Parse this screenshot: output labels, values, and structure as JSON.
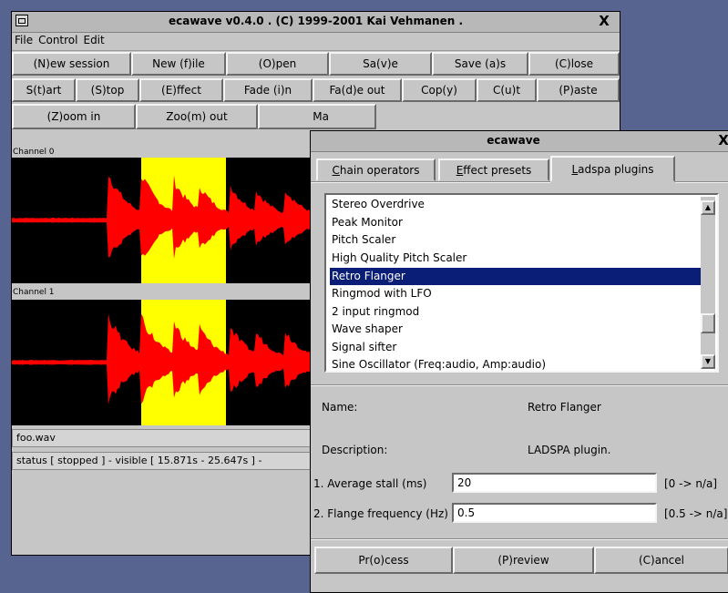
{
  "main_window": {
    "title": "ecawave v0.4.0 . (C) 1999-2001 Kai Vehmanen .",
    "close": "X",
    "menu": [
      "File",
      "Control",
      "Edit"
    ],
    "buttons_row1": [
      "(N)ew session",
      "New (f)ile",
      "(O)pen",
      "Sa(v)e",
      "Save (a)s",
      "(C)lose"
    ],
    "buttons_row2": [
      "S(t)art",
      "(S)top",
      "(E)ffect",
      "Fade (i)n",
      "Fa(d)e out",
      "Cop(y)",
      "C(u)t",
      "(P)aste"
    ],
    "buttons_row3": [
      "(Z)oom in",
      "Zoo(m) out",
      "Ma"
    ],
    "channels": [
      "Channel 0",
      "Channel 1"
    ],
    "filename": "foo.wav",
    "status": "status [ stopped ] - visible [ 15.871s - 25.647s ] -",
    "colors": {
      "waveform": "#ff0000",
      "selection": "#ffff00",
      "background": "#000000"
    }
  },
  "dialog": {
    "title": "ecawave",
    "close": "X",
    "tabs": [
      {
        "pre": "",
        "u": "C",
        "post": "hain operators"
      },
      {
        "pre": "",
        "u": "E",
        "post": "ffect presets"
      },
      {
        "pre": "",
        "u": "L",
        "post": "adspa plugins"
      }
    ],
    "plugins": [
      "Stereo Overdrive",
      "Peak Monitor",
      "Pitch Scaler",
      "High Quality Pitch Scaler",
      "Retro Flanger",
      "Ringmod with LFO",
      "2 input ringmod",
      "Wave shaper",
      "Signal sifter",
      "Sine Oscillator (Freq:audio, Amp:audio)"
    ],
    "selected_index": 4,
    "name_label": "Name:",
    "name_value": "Retro Flanger",
    "desc_label": "Description:",
    "desc_value": "LADSPA plugin.",
    "params": [
      {
        "label": "1. Average stall (ms)",
        "value": "20",
        "range": "[0 -> n/a]"
      },
      {
        "label": "2. Flange frequency (Hz)",
        "value": "0.5",
        "range": "[0.5 -> n/a]"
      }
    ],
    "buttons": [
      "Pr(o)cess",
      "(P)review",
      "(C)ancel"
    ]
  }
}
